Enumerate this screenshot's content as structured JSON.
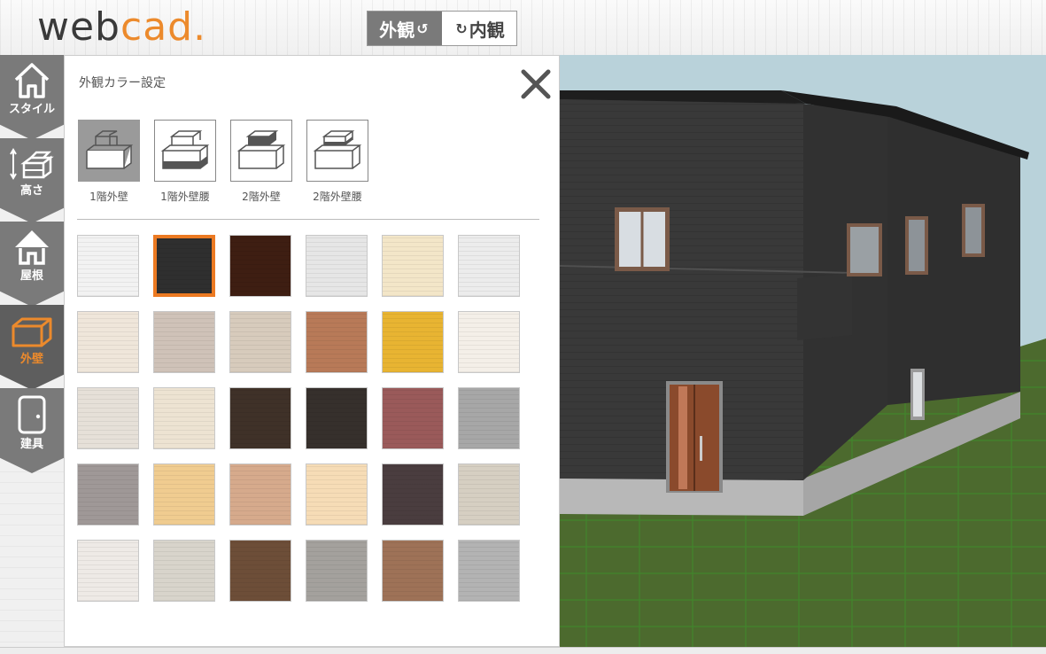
{
  "app": {
    "logo_part1": "web",
    "logo_part2": "cad",
    "logo_dot": "."
  },
  "view_toggle": {
    "exterior_label": "外観",
    "interior_label": "内観",
    "active": "exterior"
  },
  "sidebar": {
    "items": [
      {
        "label": "スタイル",
        "icon": "house-outline-icon"
      },
      {
        "label": "高さ",
        "icon": "height-blocks-icon"
      },
      {
        "label": "屋根",
        "icon": "roof-house-icon"
      },
      {
        "label": "外壁",
        "icon": "wall-box-icon",
        "active": true
      },
      {
        "label": "建具",
        "icon": "door-icon"
      }
    ]
  },
  "panel": {
    "title": "外観カラー設定",
    "tabs": [
      {
        "label": "1階外壁",
        "active": true
      },
      {
        "label": "1階外壁腰"
      },
      {
        "label": "2階外壁"
      },
      {
        "label": "2階外壁腰"
      }
    ]
  },
  "swatches": [
    [
      "#f2f2f2",
      "#2f2f2f",
      "#3e1e12",
      "#e6e6e6",
      "#f3e6c8",
      "#ececec"
    ],
    [
      "#efe6da",
      "#cfc2b8",
      "#d7cbbc",
      "#b87a58",
      "#e8b432",
      "#f4efe8"
    ],
    [
      "#e6e0d8",
      "#ede3d2",
      "#3f3128",
      "#36302c",
      "#9a5a5a",
      "#a7a7a7"
    ],
    [
      "#9f9897",
      "#f0cc90",
      "#d6aa8c",
      "#f6dcb6",
      "#4a3d3f",
      "#d6cfc2"
    ],
    [
      "#eeeae6",
      "#d8d4cb",
      "#6d4e38",
      "#a4a19d",
      "#9e7257",
      "#b3b3b3"
    ]
  ],
  "selected_swatch": {
    "row": 0,
    "col": 1
  },
  "colors": {
    "accent": "#ec8a2c",
    "sidebar_bg": "#7a7a7a",
    "wall": "#3a3a3a",
    "sky": "#b9d2da",
    "grass": "#4c6a2e"
  }
}
